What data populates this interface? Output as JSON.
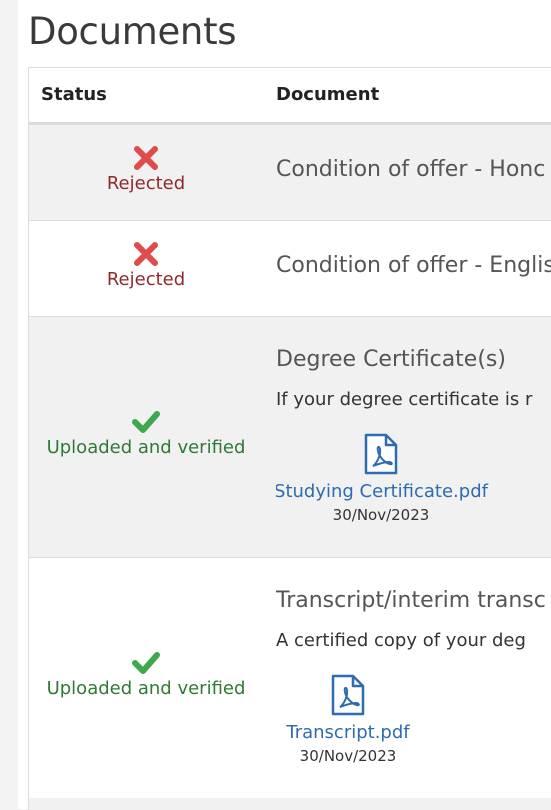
{
  "section": {
    "title": "Documents"
  },
  "table": {
    "headers": {
      "status": "Status",
      "document": "Document"
    },
    "rows": [
      {
        "status": "Rejected",
        "status_icon": "cross-icon",
        "title": "Condition of offer - Honc"
      },
      {
        "status": "Rejected",
        "status_icon": "cross-icon",
        "title": "Condition of offer - Englis"
      },
      {
        "status": "Uploaded and verified",
        "status_icon": "check-icon",
        "title": "Degree Certificate(s)",
        "description": "If your degree certificate is r",
        "file": {
          "name": "Studying Certificate.pdf",
          "date": "30/Nov/2023",
          "icon": "pdf-file-icon"
        }
      },
      {
        "status": "Uploaded and verified",
        "status_icon": "check-icon",
        "title": "Transcript/interim transc",
        "description": "A certified copy of your deg",
        "file": {
          "name": "Transcript.pdf",
          "date": "30/Nov/2023",
          "icon": "pdf-file-icon"
        }
      }
    ]
  },
  "colors": {
    "rejected": "#8f2a2a",
    "rejected_icon": "#e04b4b",
    "verified": "#2f7a34",
    "verified_icon": "#3fa84a",
    "link": "#2e6bb0"
  }
}
